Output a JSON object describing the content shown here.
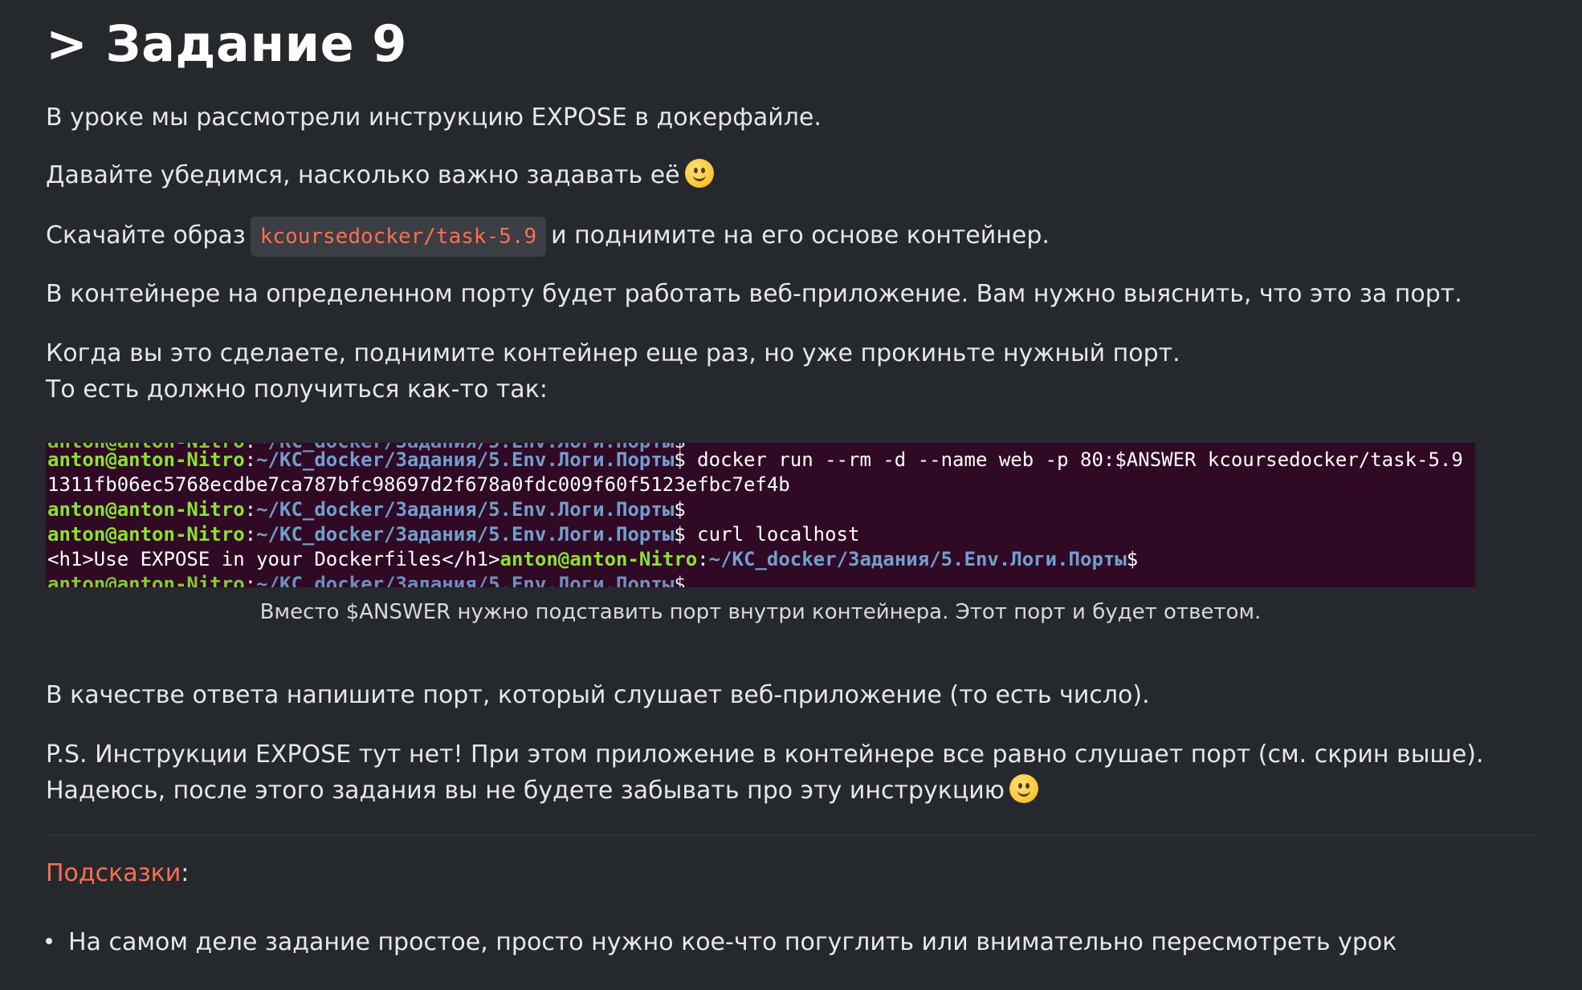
{
  "heading": "> Задание 9",
  "paragraphs": {
    "p1": "В уроке мы рассмотрели инструкцию EXPOSE в докерфайле.",
    "p2": "Давайте убедимся, насколько важно задавать её",
    "p3_before": "Скачайте образ",
    "p3_code": "kcoursedocker/task-5.9",
    "p3_after": "и поднимите на его основе контейнер.",
    "p4": "В контейнере на определенном порту будет работать веб-приложение. Вам нужно выяснить, что это за порт.",
    "p5_line1": "Когда вы это сделаете, поднимите контейнер еще раз, но уже прокиньте нужный порт.",
    "p5_line2": "То есть должно получиться как-то так:",
    "p6": "В качестве ответа напишите порт, который слушает веб-приложение (то есть число).",
    "p7_line1": "P.S. Инструкции EXPOSE тут нет! При этом приложение в контейнере все равно слушает порт (см. скрин выше).",
    "p7_line2": "Надеюсь, после этого задания вы не будете забывать про эту инструкцию"
  },
  "terminal": {
    "user": "anton@anton-Nitro",
    "path": "~/KC_docker/Задания/5.Env.Логи.Порты",
    "prompt_symbol": "$",
    "cmd1": " docker run --rm -d --name web -p 80:$ANSWER kcoursedocker/task-5.9",
    "out1": "1311fb06ec5768ecdbe7ca787bfc98697d2f678a0fdc009f60f5123efbc7ef4b",
    "cmd2": " curl localhost",
    "out2": "<h1>Use EXPOSE in your Dockerfiles</h1>"
  },
  "caption": "Вместо $ANSWER нужно подставить порт внутри контейнера. Этот порт и будет ответом.",
  "hints": {
    "label": "Подсказки",
    "colon": ":",
    "items": [
      "На самом деле задание простое, просто нужно кое-что погуглить или внимательно пересмотреть урок"
    ]
  },
  "colors": {
    "background": "#25282d",
    "accent": "#ff6e52",
    "terminal_bg": "#300a24",
    "terminal_user": "#8ae234",
    "terminal_path": "#729fcf"
  },
  "icons": [
    "slightly-smiling-face-emoji"
  ]
}
